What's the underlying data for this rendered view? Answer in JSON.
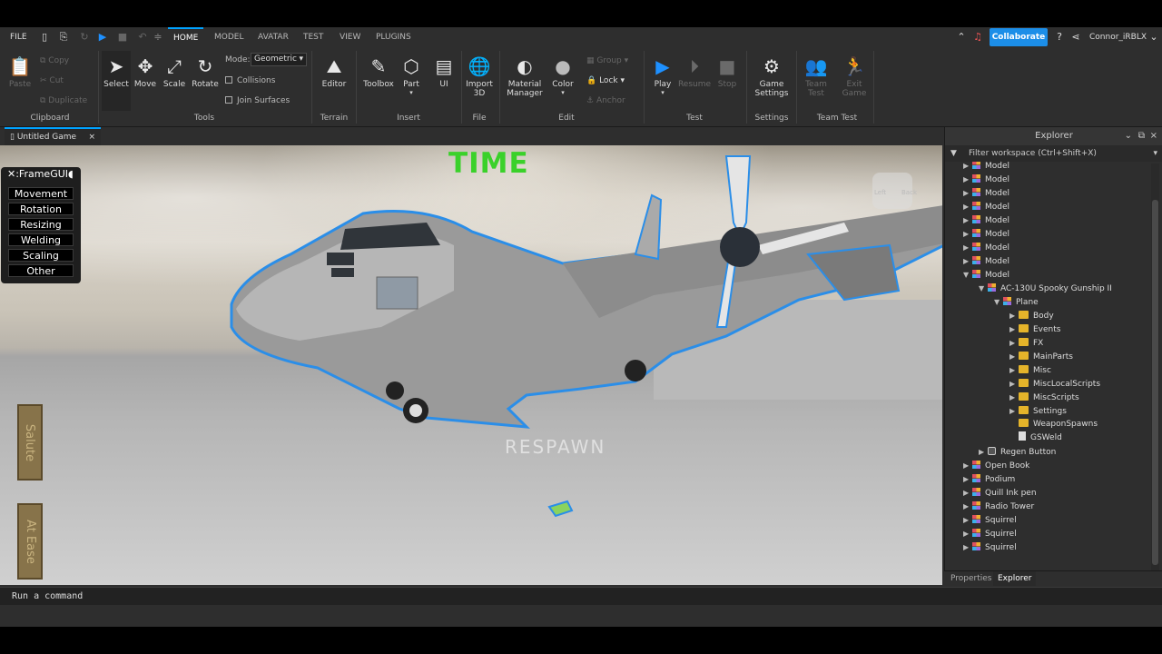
{
  "menu": {
    "file": "FILE",
    "tabs": [
      "HOME",
      "MODEL",
      "AVATAR",
      "TEST",
      "VIEW",
      "PLUGINS"
    ],
    "active_tab": "HOME",
    "collaborate": "Collaborate",
    "username": "Connor_iRBLX"
  },
  "ribbon": {
    "clipboard": {
      "paste": "Paste",
      "copy": "Copy",
      "cut": "Cut",
      "duplicate": "Duplicate",
      "label": "Clipboard"
    },
    "tools": {
      "select": "Select",
      "move": "Move",
      "scale": "Scale",
      "rotate": "Rotate",
      "mode_label": "Mode:",
      "mode_value": "Geometric",
      "collisions": "Collisions",
      "join_surfaces": "Join Surfaces",
      "label": "Tools"
    },
    "terrain": {
      "editor": "Editor",
      "label": "Terrain"
    },
    "insert": {
      "toolbox": "Toolbox",
      "part": "Part",
      "ui": "UI",
      "label": "Insert"
    },
    "file": {
      "import3d_1": "Import",
      "import3d_2": "3D",
      "label": "File"
    },
    "edit": {
      "material_1": "Material",
      "material_2": "Manager",
      "color": "Color",
      "group": "Group",
      "lock": "Lock",
      "anchor": "Anchor",
      "label": "Edit"
    },
    "test": {
      "play": "Play",
      "resume": "Resume",
      "stop": "Stop",
      "label": "Test"
    },
    "settings": {
      "game_settings_1": "Game",
      "game_settings_2": "Settings",
      "label": "Settings"
    },
    "team_test": {
      "team_test_1": "Team",
      "team_test_2": "Test",
      "exit_game_1": "Exit",
      "exit_game_2": "Game",
      "label": "Team Test"
    }
  },
  "document_tab": "Untitled Game",
  "viewport": {
    "time_label": "TIME",
    "respawn": "RESPAWN",
    "frame_gui_title": ":FrameGUI",
    "frame_gui_buttons": [
      "Movement",
      "Rotation",
      "Resizing",
      "Welding",
      "Scaling",
      "Other"
    ],
    "salute": "Salute",
    "at_ease": "At Ease",
    "viewcube_left": "Left",
    "viewcube_back": "Back"
  },
  "command_bar": {
    "placeholder": "Run a command"
  },
  "explorer": {
    "title": "Explorer",
    "filter": "Filter workspace (Ctrl+Shift+X)",
    "items": [
      {
        "label": "Model",
        "depth": 0,
        "type": "model",
        "arrow": "right"
      },
      {
        "label": "Model",
        "depth": 0,
        "type": "model",
        "arrow": "right"
      },
      {
        "label": "Model",
        "depth": 0,
        "type": "model",
        "arrow": "right"
      },
      {
        "label": "Model",
        "depth": 0,
        "type": "model",
        "arrow": "right"
      },
      {
        "label": "Model",
        "depth": 0,
        "type": "model",
        "arrow": "right"
      },
      {
        "label": "Model",
        "depth": 0,
        "type": "model",
        "arrow": "right"
      },
      {
        "label": "Model",
        "depth": 0,
        "type": "model",
        "arrow": "right"
      },
      {
        "label": "Model",
        "depth": 0,
        "type": "model",
        "arrow": "right"
      },
      {
        "label": "Model",
        "depth": 0,
        "type": "model",
        "arrow": "down"
      },
      {
        "label": "AC-130U Spooky Gunship II",
        "depth": 1,
        "type": "model",
        "arrow": "down"
      },
      {
        "label": "Plane",
        "depth": 2,
        "type": "model",
        "arrow": "down"
      },
      {
        "label": "Body",
        "depth": 3,
        "type": "folder",
        "arrow": "right"
      },
      {
        "label": "Events",
        "depth": 3,
        "type": "folder",
        "arrow": "right"
      },
      {
        "label": "FX",
        "depth": 3,
        "type": "folder",
        "arrow": "right"
      },
      {
        "label": "MainParts",
        "depth": 3,
        "type": "folder",
        "arrow": "right"
      },
      {
        "label": "Misc",
        "depth": 3,
        "type": "folder",
        "arrow": "right"
      },
      {
        "label": "MiscLocalScripts",
        "depth": 3,
        "type": "folder",
        "arrow": "right"
      },
      {
        "label": "MiscScripts",
        "depth": 3,
        "type": "folder",
        "arrow": "right"
      },
      {
        "label": "Settings",
        "depth": 3,
        "type": "folder",
        "arrow": "right"
      },
      {
        "label": "WeaponSpawns",
        "depth": 3,
        "type": "folder",
        "arrow": "none"
      },
      {
        "label": "GSWeld",
        "depth": 3,
        "type": "script",
        "arrow": "none"
      },
      {
        "label": "Regen Button",
        "depth": 1,
        "type": "part",
        "arrow": "right"
      },
      {
        "label": "Open Book",
        "depth": 0,
        "type": "model",
        "arrow": "right"
      },
      {
        "label": "Podium",
        "depth": 0,
        "type": "model",
        "arrow": "right"
      },
      {
        "label": "Quill Ink pen",
        "depth": 0,
        "type": "model",
        "arrow": "right"
      },
      {
        "label": "Radio Tower",
        "depth": 0,
        "type": "model",
        "arrow": "right"
      },
      {
        "label": "Squirrel",
        "depth": 0,
        "type": "model",
        "arrow": "right"
      },
      {
        "label": "Squirrel",
        "depth": 0,
        "type": "model",
        "arrow": "right"
      },
      {
        "label": "Squirrel",
        "depth": 0,
        "type": "model",
        "arrow": "right"
      }
    ]
  },
  "bottom_tabs": {
    "properties": "Properties",
    "explorer": "Explorer"
  }
}
